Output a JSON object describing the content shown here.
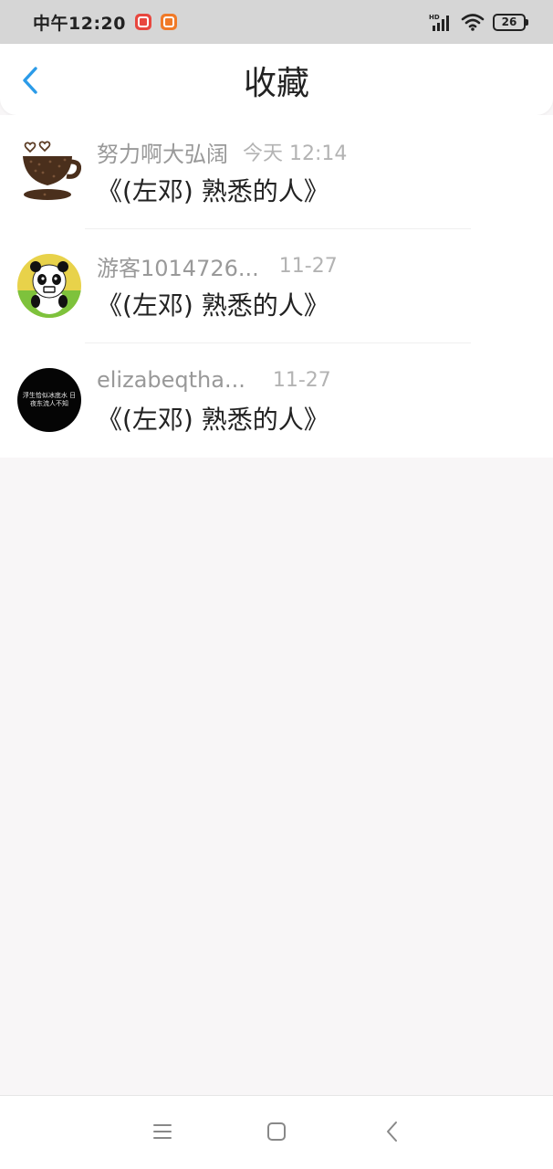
{
  "status_bar": {
    "time": "中午12:20",
    "battery": "26",
    "badge_colors": [
      "#e8473f",
      "#f07a28"
    ],
    "icons": [
      "hd-signal-icon",
      "wifi-icon",
      "battery-icon"
    ]
  },
  "header": {
    "title": "收藏",
    "back_icon": "chevron-left-icon",
    "accent": "#2b9be8"
  },
  "items": [
    {
      "user": "努力啊大弘阔",
      "time": "今天 12:14",
      "title": "《(左邓) 熟悉的人》",
      "avatar": "coffee-cup-avatar"
    },
    {
      "user": "游客1014726...",
      "time": "11-27",
      "title": "《(左邓) 熟悉的人》",
      "avatar": "panda-avatar"
    },
    {
      "user": "elizabeqtha...",
      "time": "11-27",
      "title": "《(左邓) 熟悉的人》",
      "avatar": "black-text-avatar"
    }
  ],
  "avatar_text": "浮生恰似冰底水 日夜东流人不知",
  "nav_bar": {
    "icons": [
      "menu-icon",
      "home-square-icon",
      "back-triangle-icon"
    ]
  }
}
